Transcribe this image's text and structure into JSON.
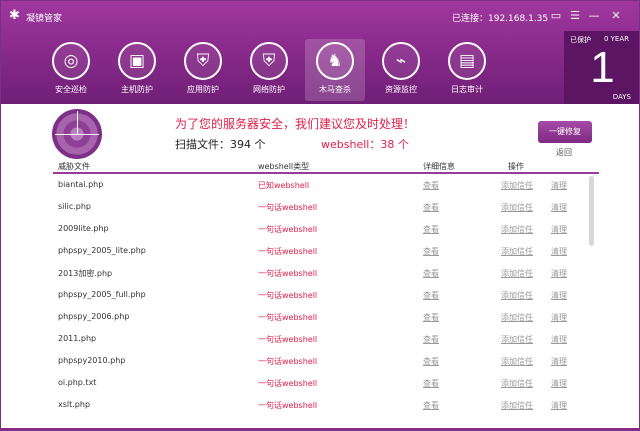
{
  "app": {
    "title": "凝镜管家",
    "connection": "已连接：192.168.1.35"
  },
  "window_controls": {
    "feedback": "▭",
    "menu": "☰",
    "minimize": "—",
    "close": "✕"
  },
  "nav": [
    {
      "label": "安全巡检",
      "icon": "◎"
    },
    {
      "label": "主机防护",
      "icon": "▣"
    },
    {
      "label": "应用防护",
      "icon": "⛨"
    },
    {
      "label": "网络防护",
      "icon": "⛨"
    },
    {
      "label": "木马查杀",
      "icon": "♞"
    },
    {
      "label": "资源监控",
      "icon": "⌁"
    },
    {
      "label": "日志审计",
      "icon": "▤"
    }
  ],
  "active_nav": "木马查杀",
  "protection": {
    "label": "已保护",
    "year": "0 YEAR",
    "days": "1",
    "days_unit": "DAYS"
  },
  "summary": {
    "advice": "为了您的服务器安全，我们建议您及时处理！",
    "scan_files": "扫描文件：394 个",
    "webshell_count": "webshell：38 个",
    "fix_button": "一键修复",
    "back": "返回"
  },
  "table": {
    "headers": [
      "威胁文件",
      "webshell类型",
      "详细信息",
      "操作"
    ],
    "rows": [
      {
        "file": "biantai.php",
        "type": "已知webshell",
        "view": "查看",
        "trust": "添加信任",
        "clean": "清理"
      },
      {
        "file": "silic.php",
        "type": "一句话webshell",
        "view": "查看",
        "trust": "添加信任",
        "clean": "清理"
      },
      {
        "file": "2009lite.php",
        "type": "一句话webshell",
        "view": "查看",
        "trust": "添加信任",
        "clean": "清理"
      },
      {
        "file": "phpspy_2005_lite.php",
        "type": "一句话webshell",
        "view": "查看",
        "trust": "添加信任",
        "clean": "清理"
      },
      {
        "file": "2013加密.php",
        "type": "一句话webshell",
        "view": "查看",
        "trust": "添加信任",
        "clean": "清理"
      },
      {
        "file": "phpspy_2005_full.php",
        "type": "一句话webshell",
        "view": "查看",
        "trust": "添加信任",
        "clean": "清理"
      },
      {
        "file": "phpspy_2006.php",
        "type": "一句话webshell",
        "view": "查看",
        "trust": "添加信任",
        "clean": "清理"
      },
      {
        "file": "2011.php",
        "type": "一句话webshell",
        "view": "查看",
        "trust": "添加信任",
        "clean": "清理"
      },
      {
        "file": "phpspy2010.php",
        "type": "一句话webshell",
        "view": "查看",
        "trust": "添加信任",
        "clean": "清理"
      },
      {
        "file": "oi.php.txt",
        "type": "一句话webshell",
        "view": "查看",
        "trust": "添加信任",
        "clean": "清理"
      },
      {
        "file": "xslt.php",
        "type": "一句话webshell",
        "view": "查看",
        "trust": "添加信任",
        "clean": "清理"
      }
    ]
  },
  "colors": {
    "header_top": "#a0389f",
    "header_bottom": "#6f1f76",
    "accent_red": "#e0204b",
    "protect_box": "#5b1562"
  }
}
